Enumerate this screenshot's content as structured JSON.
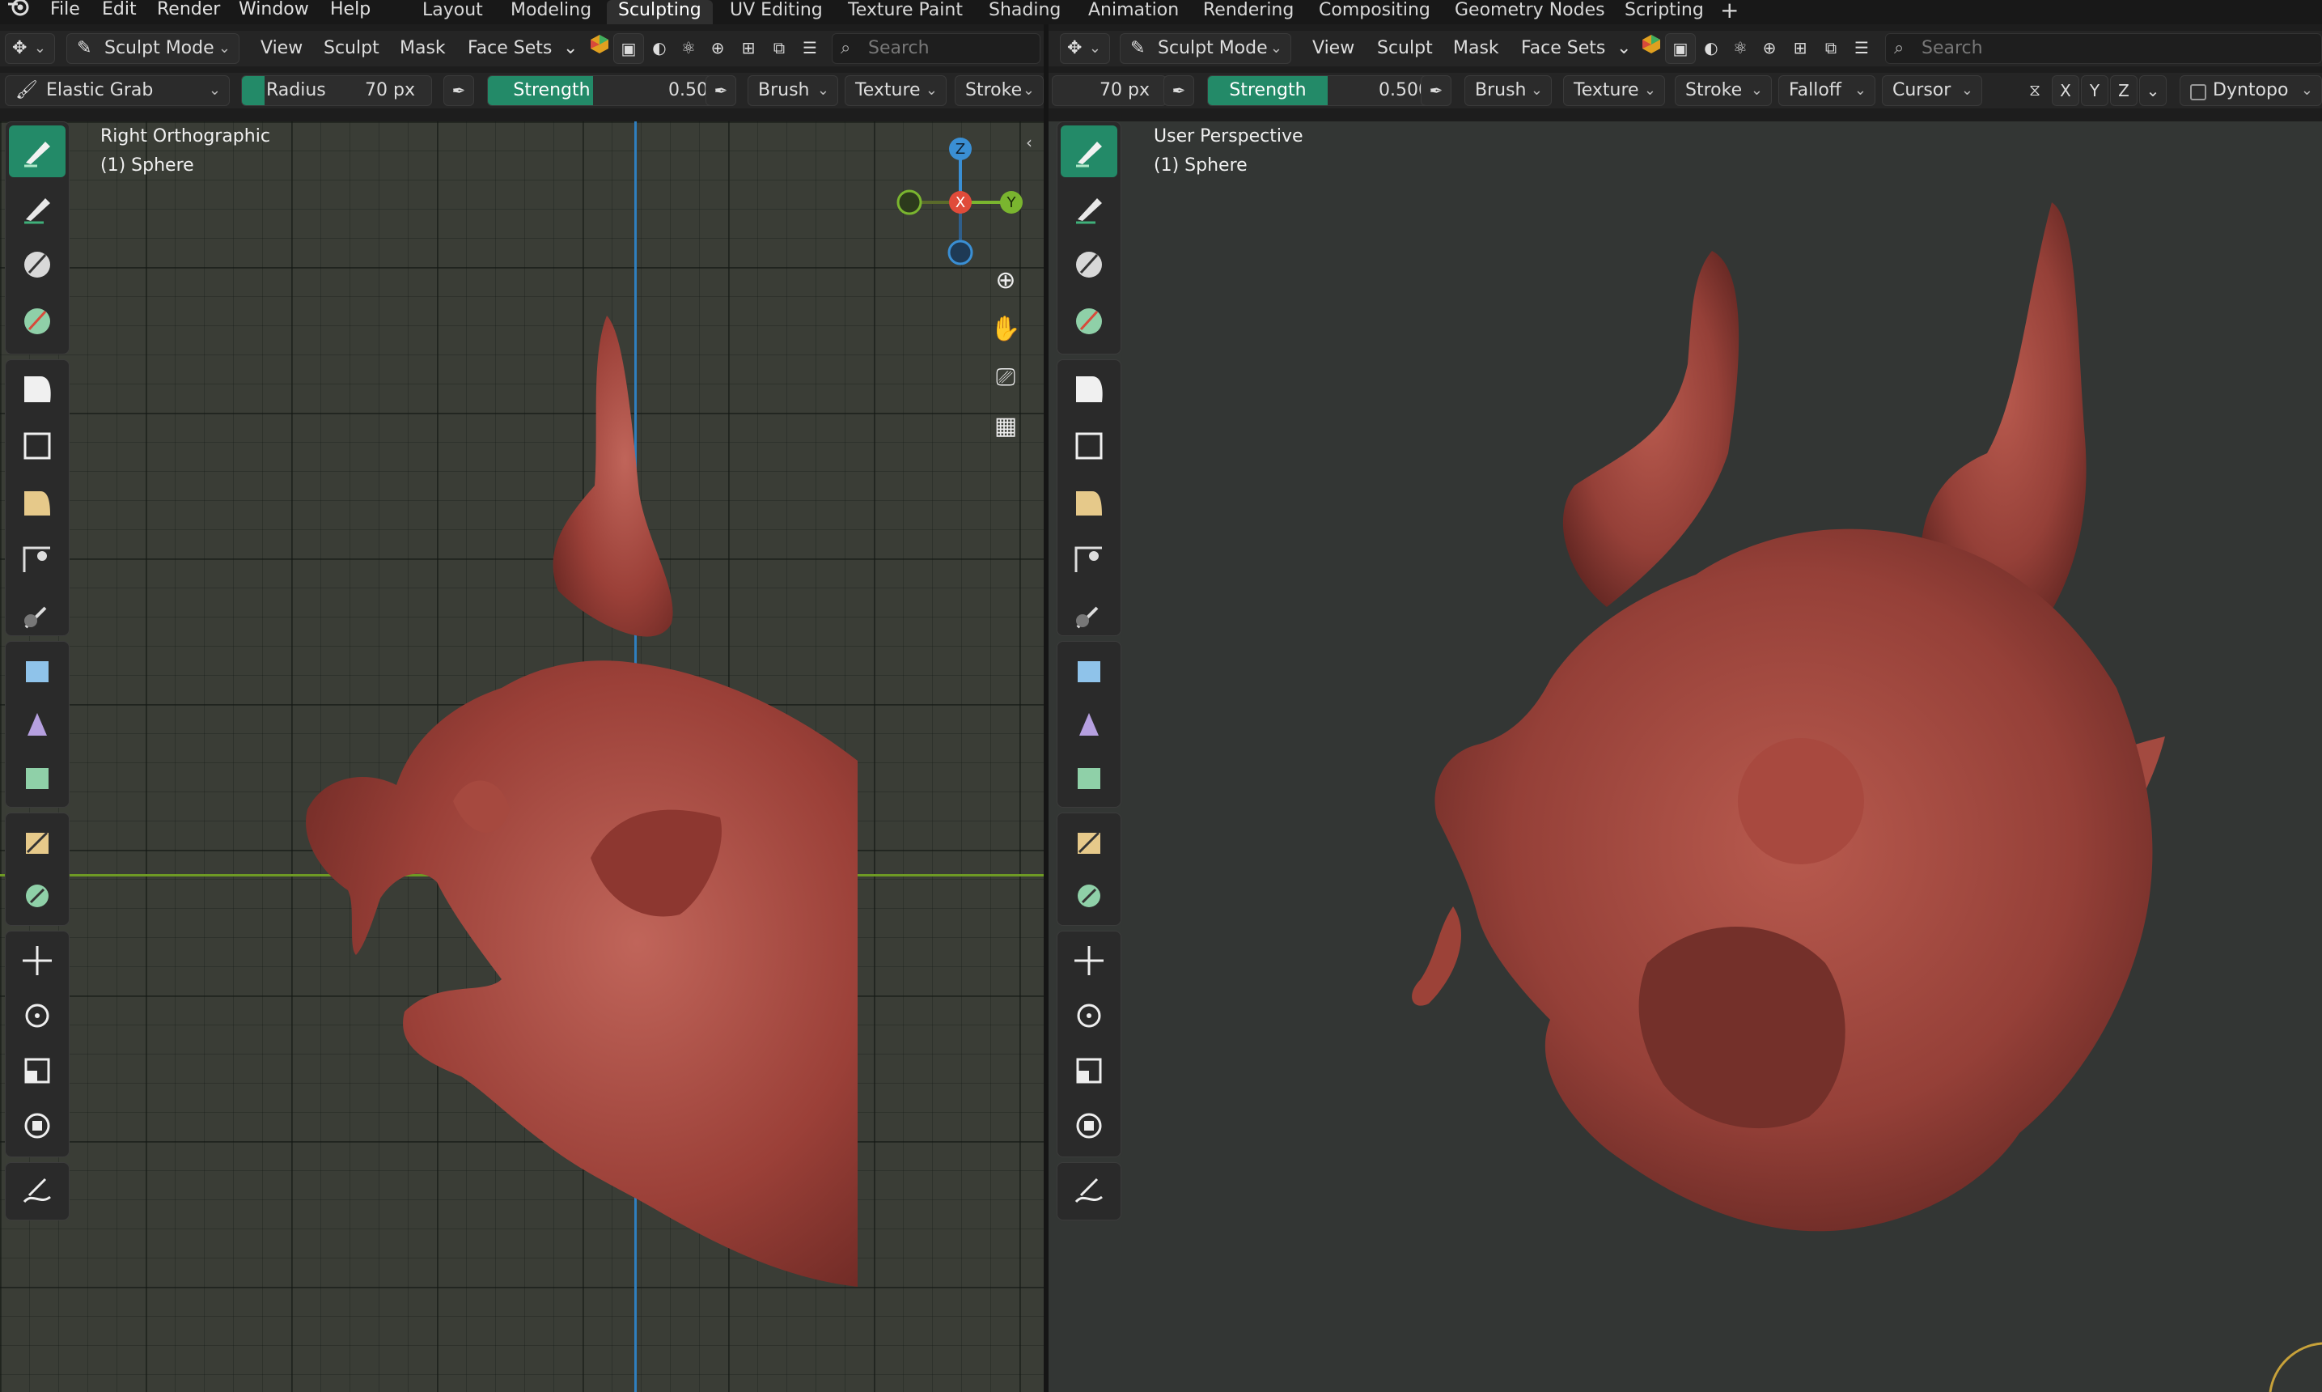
{
  "topbar": {
    "menus": [
      "File",
      "Edit",
      "Render",
      "Window",
      "Help"
    ],
    "workspaces": [
      "Layout",
      "Modeling",
      "Sculpting",
      "UV Editing",
      "Texture Paint",
      "Shading",
      "Animation",
      "Rendering",
      "Compositing",
      "Geometry Nodes",
      "Scripting"
    ],
    "active_workspace": "Sculpting",
    "add_label": "+"
  },
  "left": {
    "mode": "Sculpt Mode",
    "header_menus": [
      "View",
      "Sculpt",
      "Mask",
      "Face Sets"
    ],
    "search_placeholder": "Search",
    "brush_name": "Elastic Grab",
    "radius_label": "Radius",
    "radius_value": "70 px",
    "strength_label": "Strength",
    "strength_value": "0.500",
    "dropdowns": [
      "Brush",
      "Texture",
      "Stroke"
    ],
    "view_label": "Right Orthographic",
    "object_label": "(1) Sphere",
    "gizmo": {
      "z": "Z",
      "x": "X",
      "y": "Y"
    }
  },
  "right": {
    "mode": "Sculpt Mode",
    "header_menus": [
      "View",
      "Sculpt",
      "Mask",
      "Face Sets"
    ],
    "search_placeholder": "Search",
    "radius_value": "70 px",
    "strength_label": "Strength",
    "strength_value": "0.500",
    "dropdowns": [
      "Brush",
      "Texture",
      "Stroke",
      "Falloff",
      "Cursor"
    ],
    "axes": [
      "X",
      "Y",
      "Z"
    ],
    "dyntopo_label": "Dyntopo",
    "view_label": "User Perspective",
    "object_label": "(1) Sphere"
  },
  "colors": {
    "accent": "#238a68",
    "mesh": "#a5473f",
    "gizmo_x": "#e04b3a",
    "gizmo_y": "#7ab52f",
    "gizmo_z": "#3a8fd4"
  }
}
